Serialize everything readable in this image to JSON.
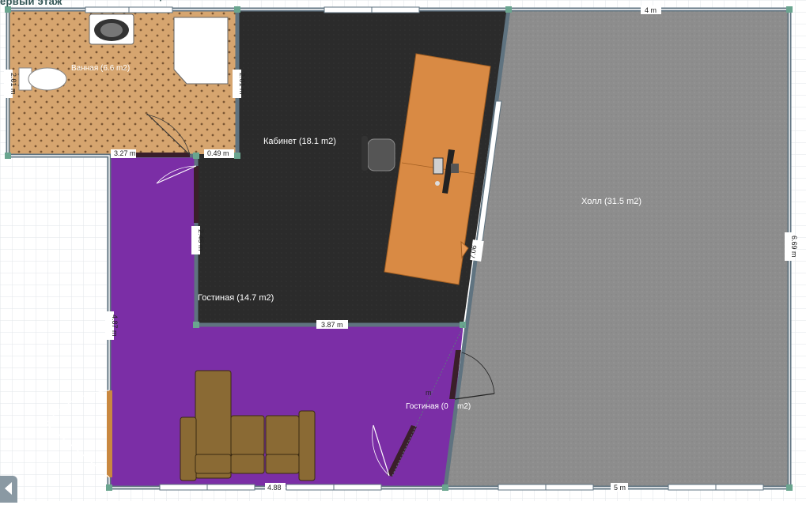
{
  "floor_selector": {
    "label": "ервый этаж",
    "chevron_icon": "chevron-down-icon"
  },
  "rooms": {
    "bathroom": {
      "label": "Ванная (6.6 m2)"
    },
    "office": {
      "label": "Кабинет (18.1 m2)"
    },
    "hall": {
      "label": "Холл (31.5 m2)"
    },
    "living": {
      "label": "Гостиная (14.7 m2)"
    },
    "living_small": {
      "label": "Гостиная (0",
      "label_tail": "m2)",
      "mid_label": "m"
    }
  },
  "dimensions": {
    "bath_left": "2.01 m",
    "bath_right": "2.01 m",
    "bath_bottom": "3.27 m",
    "corridor_small": "0.49 m",
    "office_left": "2.46 m",
    "office_bottom": "3.87 m",
    "diagonal_wall": "7.06",
    "hall_top": "4 m",
    "hall_right": "6.69 m",
    "hall_bottom": "5 m",
    "living_left": "4.87 m",
    "living_bottom": "4.88"
  },
  "colors": {
    "bathroom_floor": "#d4a26f",
    "office_floor": "#2a2a2a",
    "hall_floor": "#8e8e8e",
    "living_floor": "#7c2fa8",
    "desk": "#d88a45",
    "sofa": "#8b6a36",
    "wall": "#5d6f7a"
  }
}
